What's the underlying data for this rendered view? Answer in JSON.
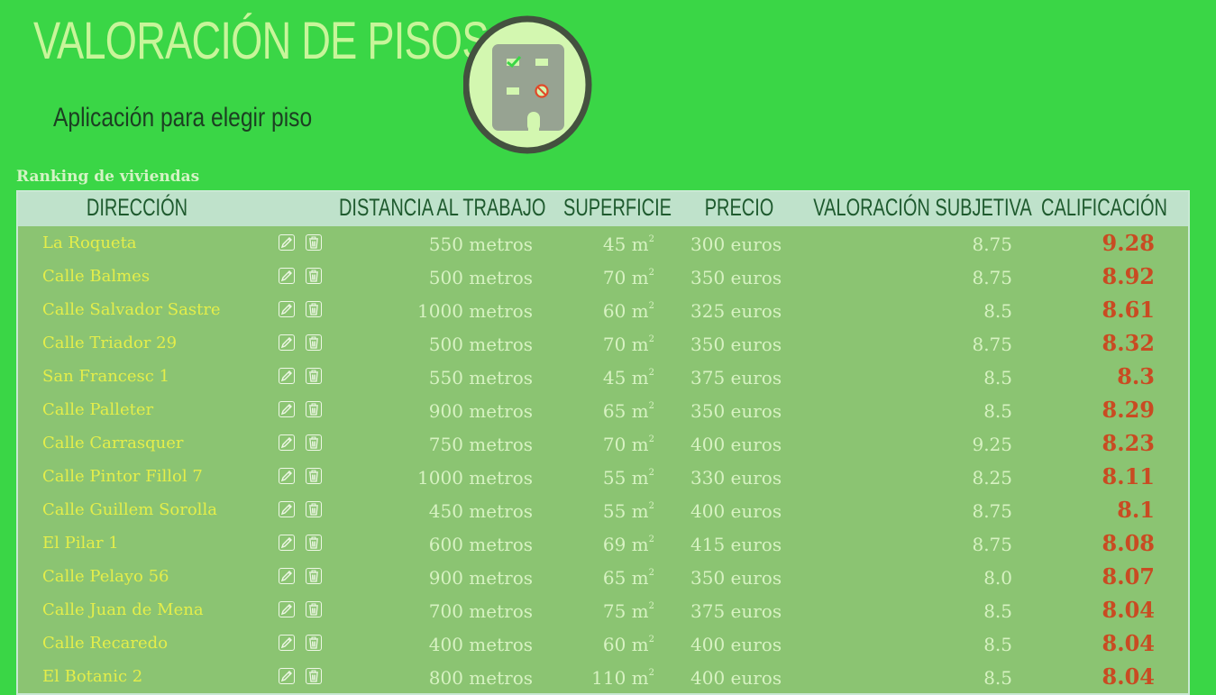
{
  "header": {
    "title": "VALORACIÓN DE PISOS",
    "subtitle": "Aplicación para elegir piso",
    "logo_icon": "building-icon"
  },
  "ranking_label": "Ranking de viviendas",
  "table": {
    "columns": [
      "DIRECCIÓN",
      "DISTANCIA AL TRABAJO",
      "SUPERFICIE",
      "PRECIO",
      "VALORACIÓN SUBJETIVA",
      "CALIFICACIÓN"
    ],
    "rows": [
      {
        "direccion": "La Roqueta",
        "distancia": "550 metros",
        "superficie": "45 m",
        "precio": "300 euros",
        "valoracion": "8.75",
        "calificacion": "9.28"
      },
      {
        "direccion": "Calle Balmes",
        "distancia": "500 metros",
        "superficie": "70 m",
        "precio": "350 euros",
        "valoracion": "8.75",
        "calificacion": "8.92"
      },
      {
        "direccion": "Calle Salvador Sastre",
        "distancia": "1000 metros",
        "superficie": "60 m",
        "precio": "325 euros",
        "valoracion": "8.5",
        "calificacion": "8.61"
      },
      {
        "direccion": "Calle Triador 29",
        "distancia": "500 metros",
        "superficie": "70 m",
        "precio": "350 euros",
        "valoracion": "8.75",
        "calificacion": "8.32"
      },
      {
        "direccion": "San Francesc 1",
        "distancia": "550 metros",
        "superficie": "45 m",
        "precio": "375 euros",
        "valoracion": "8.5",
        "calificacion": "8.3"
      },
      {
        "direccion": "Calle Palleter",
        "distancia": "900 metros",
        "superficie": "65 m",
        "precio": "350 euros",
        "valoracion": "8.5",
        "calificacion": "8.29"
      },
      {
        "direccion": "Calle Carrasquer",
        "distancia": "750 metros",
        "superficie": "70 m",
        "precio": "400 euros",
        "valoracion": "9.25",
        "calificacion": "8.23"
      },
      {
        "direccion": "Calle Pintor Fillol 7",
        "distancia": "1000 metros",
        "superficie": "55 m",
        "precio": "330 euros",
        "valoracion": "8.25",
        "calificacion": "8.11"
      },
      {
        "direccion": "Calle Guillem Sorolla",
        "distancia": "450 metros",
        "superficie": "55 m",
        "precio": "400 euros",
        "valoracion": "8.75",
        "calificacion": "8.1"
      },
      {
        "direccion": "El Pilar 1",
        "distancia": "600 metros",
        "superficie": "69 m",
        "precio": "415 euros",
        "valoracion": "8.75",
        "calificacion": "8.08"
      },
      {
        "direccion": "Calle Pelayo 56",
        "distancia": "900 metros",
        "superficie": "65 m",
        "precio": "350 euros",
        "valoracion": "8.0",
        "calificacion": "8.07"
      },
      {
        "direccion": "Calle Juan de Mena",
        "distancia": "700 metros",
        "superficie": "75 m",
        "precio": "375 euros",
        "valoracion": "8.5",
        "calificacion": "8.04"
      },
      {
        "direccion": "Calle Recaredo",
        "distancia": "400 metros",
        "superficie": "60 m",
        "precio": "400 euros",
        "valoracion": "8.5",
        "calificacion": "8.04"
      },
      {
        "direccion": "El Botanic 2",
        "distancia": "800 metros",
        "superficie": "110 m",
        "precio": "400 euros",
        "valoracion": "8.5",
        "calificacion": "8.04"
      }
    ],
    "superscript": "2",
    "row_icons": [
      "edit-icon",
      "trash-icon"
    ]
  },
  "colors": {
    "background": "#3ad646",
    "title": "#c8f59a",
    "table_body": "#8bc472",
    "address_text": "#e4ee4a",
    "score_text": "#c94b22"
  }
}
